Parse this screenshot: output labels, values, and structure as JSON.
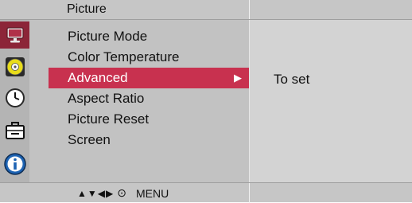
{
  "header": {
    "title": "Picture"
  },
  "sidebar": {
    "icons": [
      {
        "name": "picture-icon",
        "selected": true
      },
      {
        "name": "sound-icon",
        "selected": false
      },
      {
        "name": "time-icon",
        "selected": false
      },
      {
        "name": "option-icon",
        "selected": false
      },
      {
        "name": "information-icon",
        "selected": false
      }
    ]
  },
  "menu": {
    "items": [
      {
        "label": "Picture Mode",
        "selected": false
      },
      {
        "label": "Color Temperature",
        "selected": false
      },
      {
        "label": "Advanced",
        "selected": true
      },
      {
        "label": "Aspect Ratio",
        "selected": false
      },
      {
        "label": "Picture Reset",
        "selected": false
      },
      {
        "label": "Screen",
        "selected": false
      }
    ],
    "submenu_arrow": "▶"
  },
  "info": {
    "text": "To set"
  },
  "footer": {
    "nav_arrows": "▲▼◀▶",
    "enter_symbol": "⊙",
    "menu_label": "MENU"
  },
  "colors": {
    "highlight": "#c8314f",
    "icon_selected_bg": "#8c2538"
  }
}
